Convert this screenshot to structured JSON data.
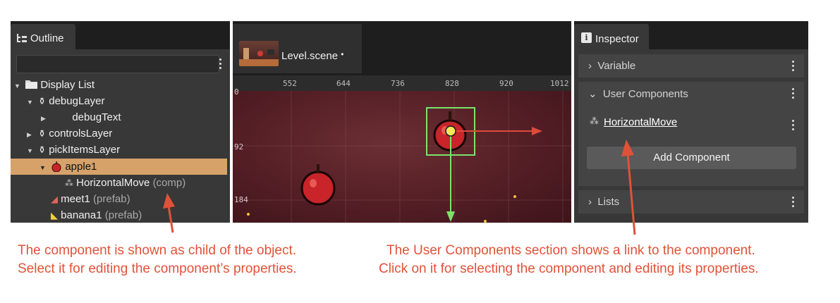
{
  "outline": {
    "tab_label": "Outline",
    "tree": [
      {
        "label": "Display List",
        "suffix": ""
      },
      {
        "label": "debugLayer",
        "suffix": ""
      },
      {
        "label": "debugText",
        "suffix": ""
      },
      {
        "label": "controlsLayer",
        "suffix": ""
      },
      {
        "label": "pickItemsLayer",
        "suffix": ""
      },
      {
        "label": "apple1",
        "suffix": ""
      },
      {
        "label": "HorizontalMove",
        "suffix": "(comp)"
      },
      {
        "label": "meet1",
        "suffix": "(prefab)"
      },
      {
        "label": "banana1",
        "suffix": "(prefab)"
      }
    ]
  },
  "scene": {
    "tab_label": "Level.scene",
    "modified_marker": "•",
    "ruler_top": [
      "552",
      "644",
      "736",
      "828",
      "920",
      "1012"
    ],
    "ruler_left": [
      "0",
      "92",
      "184"
    ]
  },
  "inspector": {
    "tab_label": "Inspector",
    "sections": {
      "variable": "Variable",
      "user_components": "User Components",
      "lists": "Lists"
    },
    "component_link": "HorizontalMove",
    "add_component_label": "Add Component"
  },
  "captions": {
    "left_line1": "The component is shown as child of the object.",
    "left_line2": "Select it for editing the component’s properties.",
    "right_line1": "The User Components section shows a link to the component.",
    "right_line2": "Click on it for selecting the component and editing its properties."
  },
  "colors": {
    "selection": "#d6a26a",
    "caption": "#e05238",
    "gizmo_x": "#e04a3a",
    "gizmo_y": "#7be36b"
  }
}
